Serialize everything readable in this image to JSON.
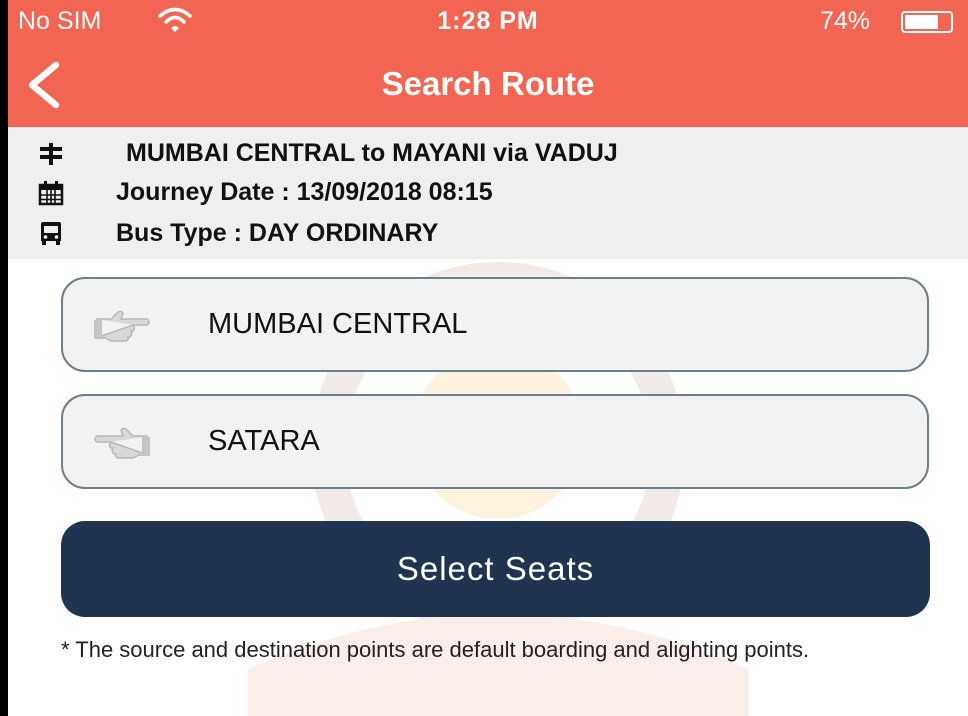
{
  "status_bar": {
    "carrier": "No SIM",
    "time": "1:28 PM",
    "battery": "74%",
    "battery_level": 0.74
  },
  "nav": {
    "title": "Search Route",
    "back_icon": "chevron-left-icon"
  },
  "route_info": {
    "route": "MUMBAI CENTRAL to MAYANI via VADUJ",
    "journey_date": "Journey Date : 13/09/2018 08:15",
    "bus_type": "Bus Type : DAY ORDINARY",
    "icons": [
      "route-sign-icon",
      "calendar-icon",
      "bus-icon"
    ]
  },
  "form": {
    "source": "MUMBAI CENTRAL",
    "destination": "SATARA",
    "source_icon": "hand-point-right-icon",
    "destination_icon": "hand-point-left-icon",
    "submit_label": "Select Seats",
    "note": "* The source and destination points are default boarding and alighting points."
  },
  "colors": {
    "header": "#f26552",
    "info_background": "#efefef",
    "button": "#1f3451",
    "field_background": "#f2f2f2"
  }
}
